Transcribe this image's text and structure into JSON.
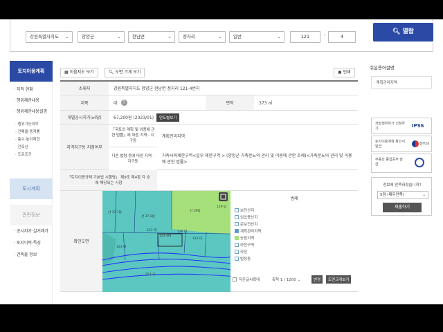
{
  "search": {
    "province": "강원특별자치도",
    "county": "양양군",
    "town": "현남면",
    "village": "정자리",
    "land_type": "일반",
    "main_no": "121",
    "separator": "-",
    "sub_no": "4",
    "read_button": "열람"
  },
  "leftnav": {
    "title": "토지이용계획",
    "items": [
      "지적 현황",
      "행위제한내용",
      "행위제한내용설명"
    ],
    "subitems": [
      "행위가능여부",
      "건폐율·용적률",
      "층수·높이제한",
      "건축선",
      "도로조건"
    ],
    "block1": "도시계획",
    "block2": "관련정보",
    "items2": [
      "공시지가·실거래가",
      "토지이력·특성",
      "건축물 정보"
    ]
  },
  "toolbar": {
    "map_view": "이음지도 보기",
    "zoom_view": "도면 크게 보기",
    "print": "인쇄"
  },
  "table": {
    "location_label": "소재지",
    "location": "강원특별자치도 양양군 현남면 정자리 121-4번지",
    "category_label": "지목",
    "category": "대",
    "area_label": "면적",
    "area": "373 ㎡",
    "price_label": "개별공시지가(㎡당)",
    "price": "67,200원 (2023/01)",
    "price_button": "연도별보기",
    "zone_label": "지역지구등 지정여부",
    "law1_label": "「국토의 계획 및 이용에 관한 법률」에 따른 지역 · 지구등",
    "law1_value": "계획관리지역",
    "law2_label": "다른 법령 등에 따른 지역 · 지구등",
    "law2_value": "가축사육제한구역<일부 제한구역 > (양양군 가축분뇨의 관리 및 이용에 관한 조례)<가축분뇨의 관리 및 이용에 관한 법률>",
    "rule_label": "「토지이용규제 기본법 시행령」 제9조 제4항 각 호에 해당되는 사항",
    "map_label": "확인도면"
  },
  "map": {
    "legend_title": "범례",
    "legend_items": [
      {
        "label": "보전산지",
        "color": "#ffffff"
      },
      {
        "label": "임업용산지",
        "color": "#ffffff"
      },
      {
        "label": "준보전산지",
        "color": "#ffffff"
      },
      {
        "label": "계획관리지역",
        "color": "#5b95c8"
      },
      {
        "label": "농림지역",
        "color": "#a6e07a"
      },
      {
        "label": "하천구역",
        "color": "#ffffff"
      },
      {
        "label": "하천",
        "color": "#ffffff"
      },
      {
        "label": "법정동",
        "color": "#ffffff"
      }
    ],
    "small_text_label": "작은글씨확대",
    "scale_text": "축척 1 /",
    "scale_value": "1200",
    "change_button": "변경",
    "zoom_button": "도면크게보기",
    "parcels": [
      "산 37-1답",
      "산 37-2답",
      "산 19답",
      "121-4대",
      "123 대",
      "122 대",
      "121 대",
      "126 대",
      "251 구",
      "129 답"
    ]
  },
  "rightbar": {
    "title": "쉬운용어설명",
    "term": "계획관리지역",
    "cards": [
      {
        "text": "개발행위허가 신청하기",
        "logo": "IPSS"
      },
      {
        "text": "토지이용계획 확인서 발급",
        "logo": "정부24"
      },
      {
        "text": "부동산 종합공부 발급",
        "logo": "일사편리"
      }
    ],
    "satisfaction_q": "정보에 만족하셨습니까?",
    "satisfaction_value": "5점 (매우만족)",
    "submit": "제출하기"
  },
  "colors": {
    "accent": "#2b4aa6",
    "map_planned": "#5bc7c0",
    "map_agri": "#a6e07a"
  }
}
